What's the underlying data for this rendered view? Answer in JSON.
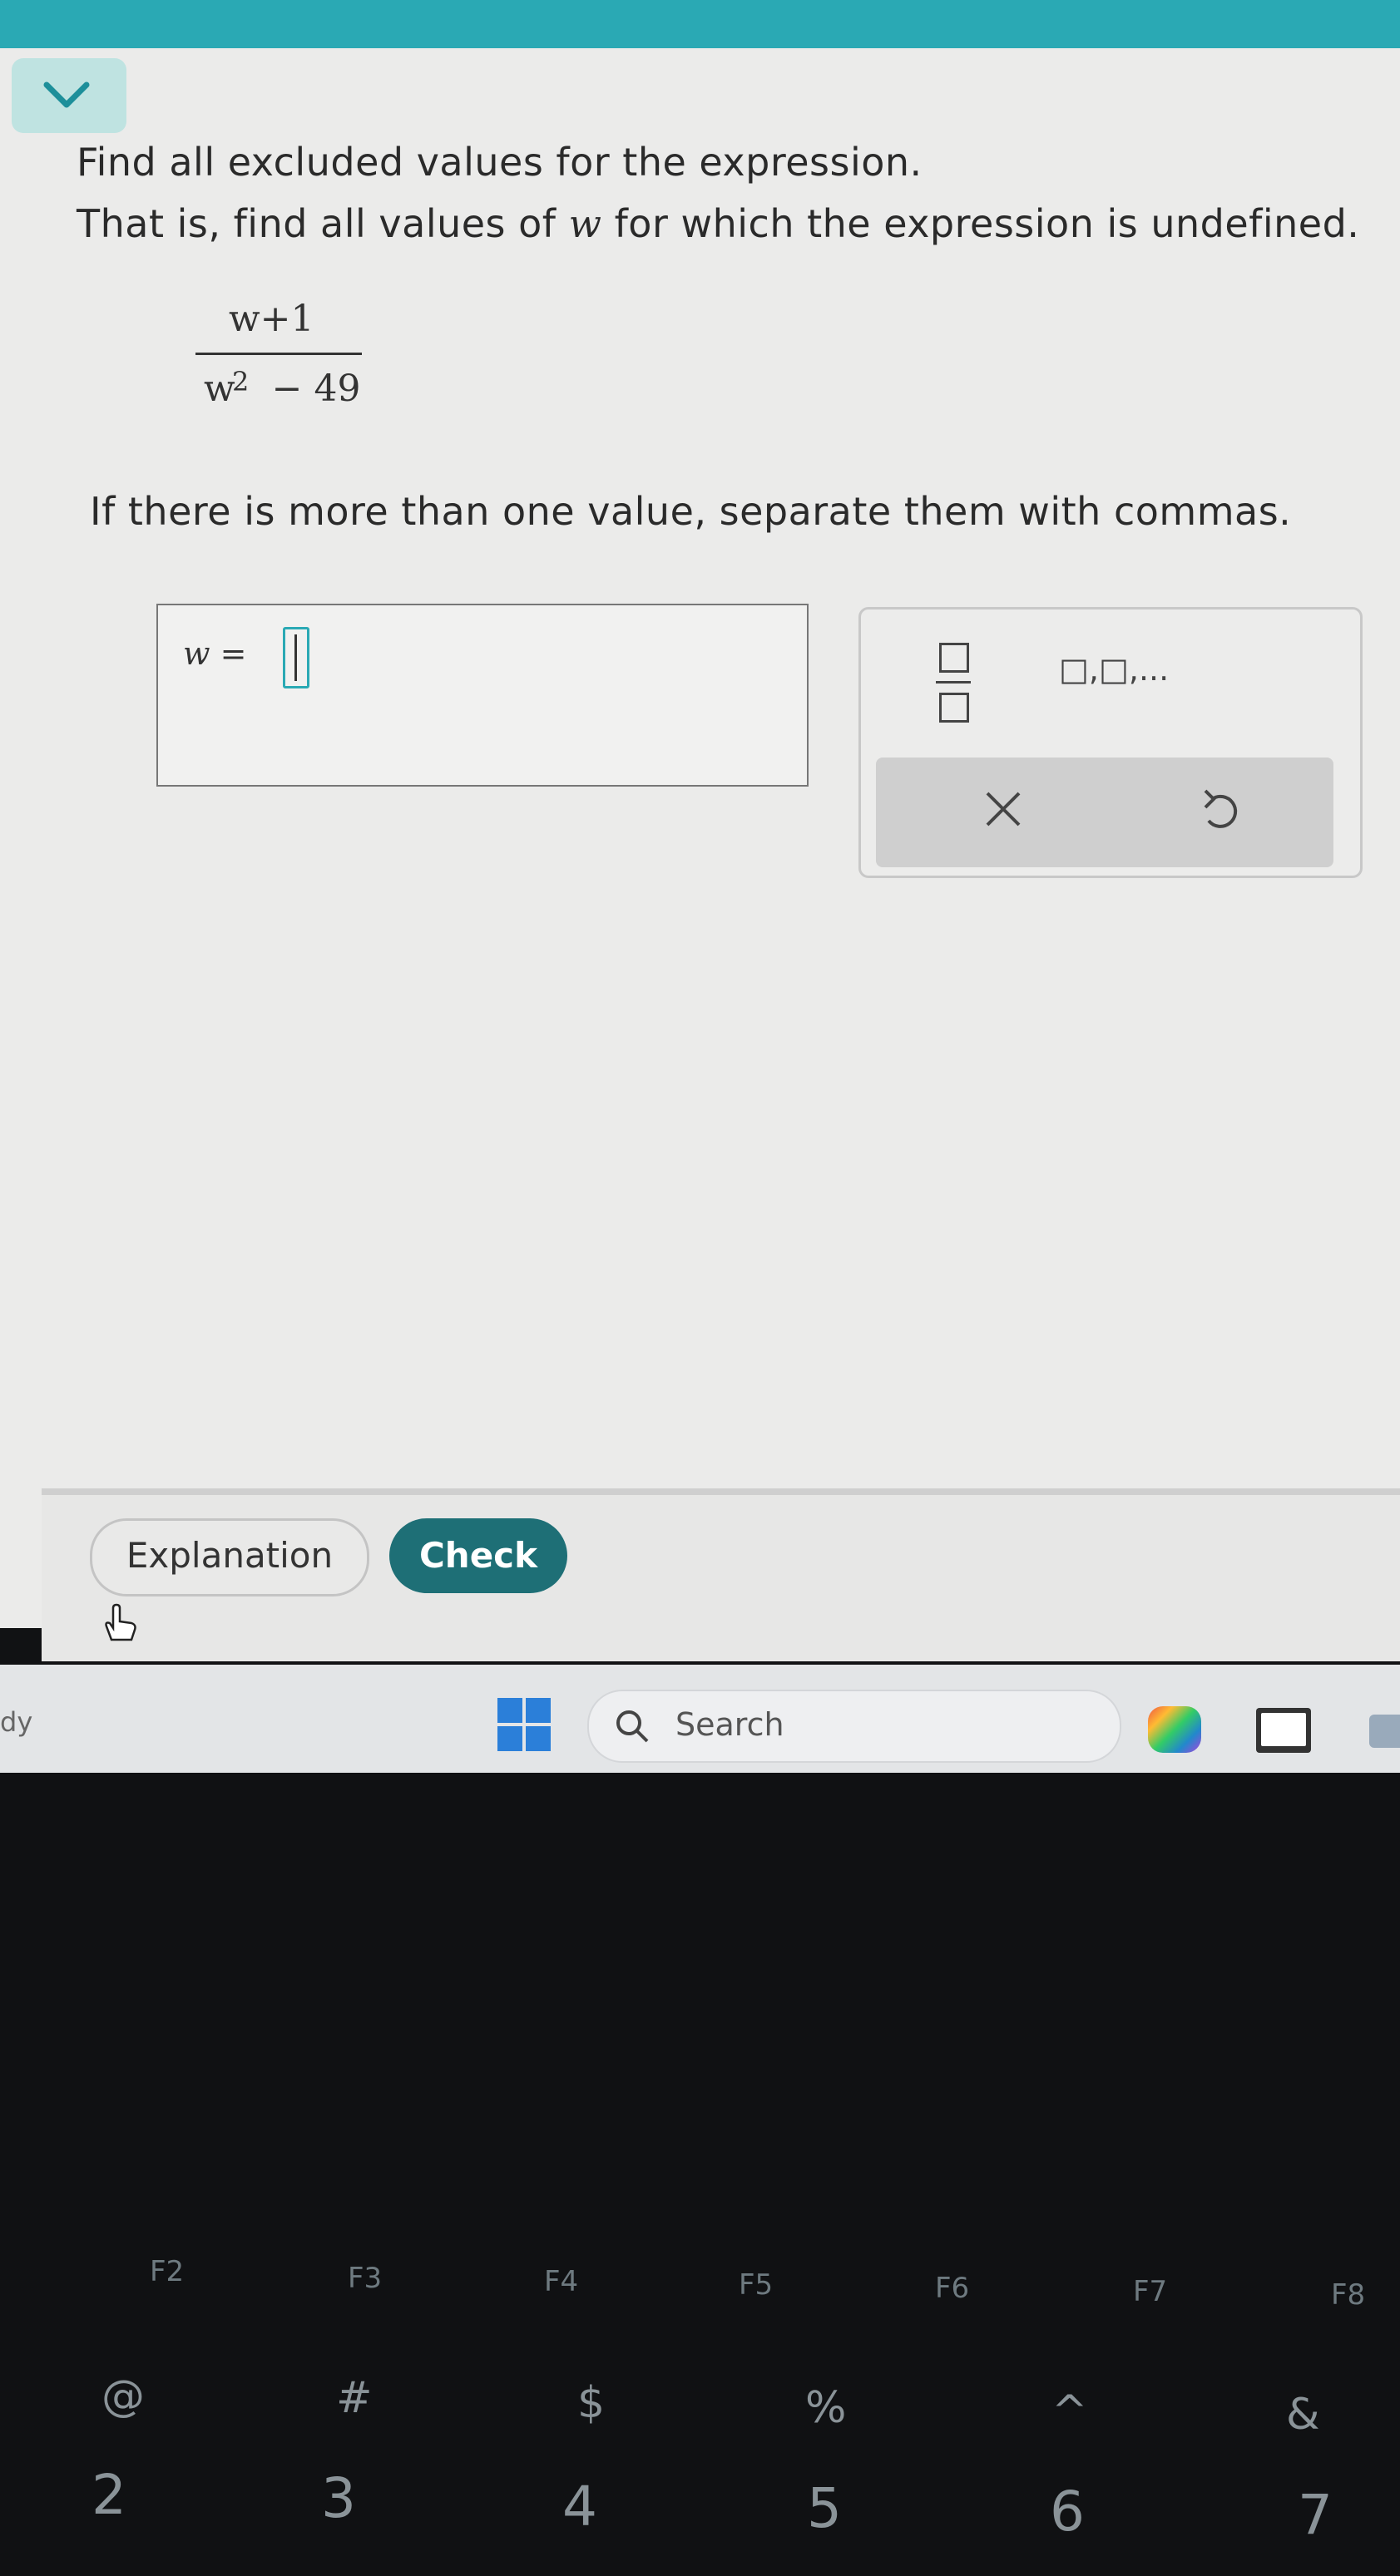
{
  "problem": {
    "line1": "Find all excluded values for the expression.",
    "line2_before": "That is, find all values of ",
    "line2_var": "w",
    "line2_after": " for which the expression is undefined.",
    "numerator": "w+1",
    "denominator_var": "w",
    "denominator_rest": "− 49",
    "exponent": "2",
    "instruction": "If there is more than one value, separate them with commas."
  },
  "answer": {
    "lhs": "w =",
    "value": ""
  },
  "keypad": {
    "list_symbol": "□,□,..."
  },
  "buttons": {
    "explanation": "Explanation",
    "check": "Check"
  },
  "taskbar": {
    "left_text": "dy",
    "search_placeholder": "Search"
  },
  "keyboard": {
    "fkeys": [
      "F2",
      "F3",
      "F4",
      "F5",
      "F6",
      "F7",
      "F8"
    ],
    "number_keys": [
      {
        "shift": "@",
        "main": "2"
      },
      {
        "shift": "#",
        "main": "3"
      },
      {
        "shift": "$",
        "main": "4"
      },
      {
        "shift": "%",
        "main": "5"
      },
      {
        "shift": "^",
        "main": "6"
      },
      {
        "shift": "&",
        "main": "7"
      }
    ]
  },
  "colors": {
    "accent": "#2aa9b4",
    "check_button": "#1e6f76",
    "background": "#ebebea"
  }
}
